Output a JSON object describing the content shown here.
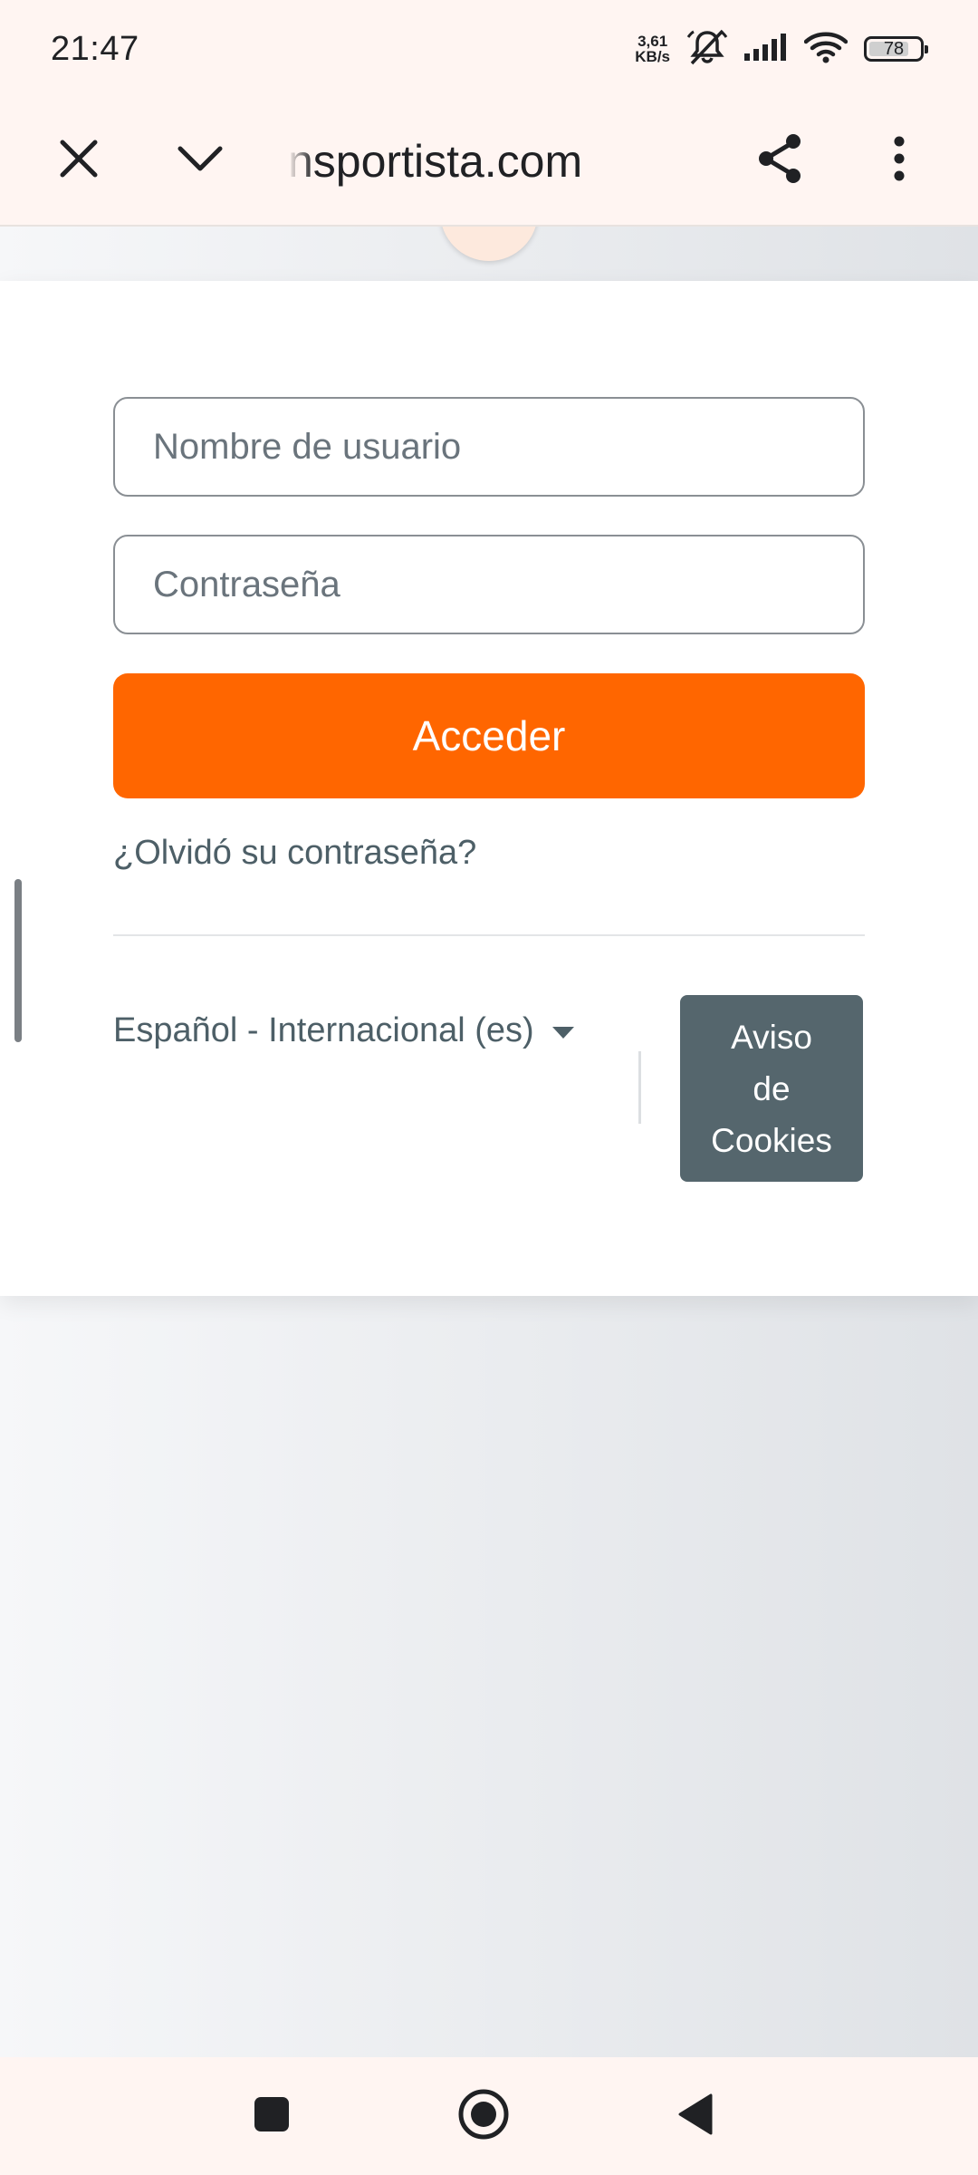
{
  "status_bar": {
    "time": "21:47",
    "net_speed_value": "3,61",
    "net_speed_unit": "KB/s",
    "battery": "78",
    "icons": [
      "silent-mode-icon",
      "signal-icon",
      "wifi-icon",
      "battery-icon"
    ]
  },
  "browser": {
    "url": "nsportista.com",
    "close_icon": "close-icon",
    "minimize_icon": "chevron-down-icon",
    "share_icon": "share-icon",
    "menu_icon": "more-vert-icon"
  },
  "login": {
    "username_placeholder": "Nombre de usuario",
    "password_placeholder": "Contraseña",
    "login_label": "Acceder",
    "forgot_label": "¿Olvidó su contraseña?",
    "language_label": "Español - Internacional (es)",
    "cookies_label": "Aviso\nde\nCookies"
  },
  "navigation": {
    "recents_icon": "square-icon",
    "home_icon": "home-circle-icon",
    "back_icon": "back-triangle-icon"
  },
  "colors": {
    "accent": "#ff6600",
    "cookies_button": "#55666d",
    "link_text": "#4d5f67",
    "bar_background": "#fff5f2"
  }
}
